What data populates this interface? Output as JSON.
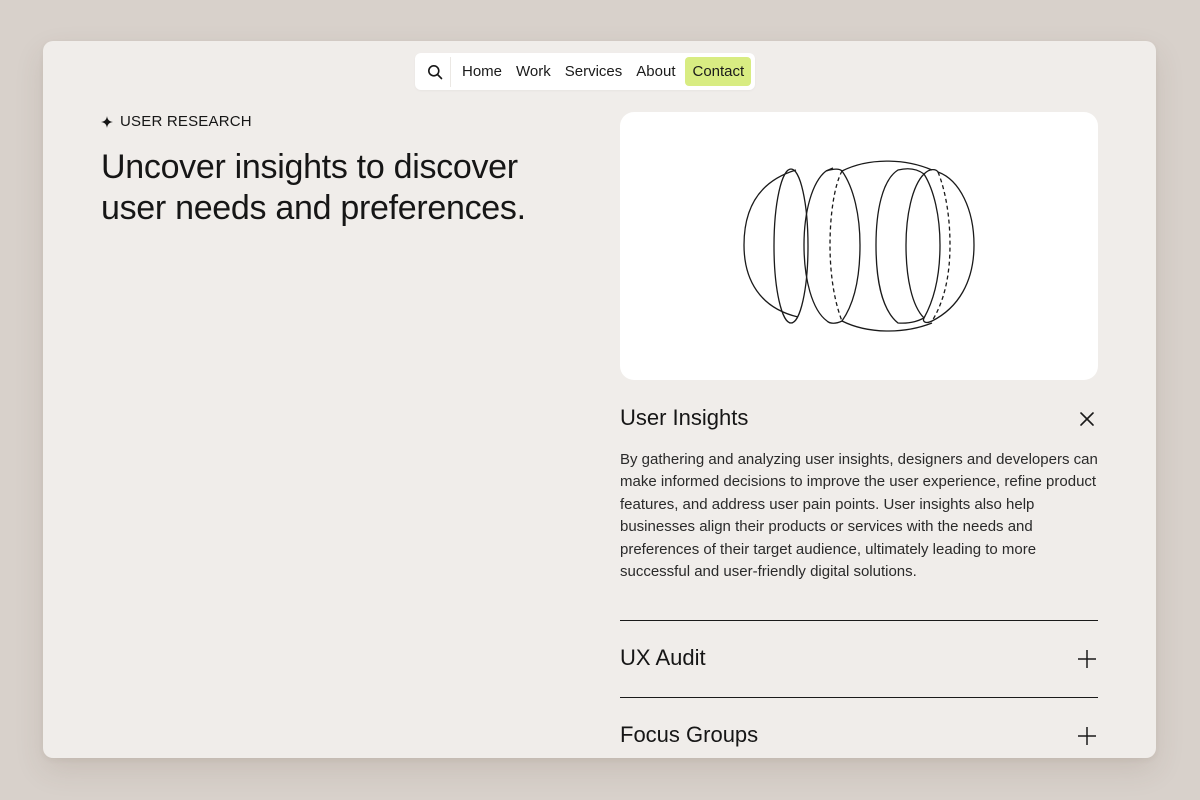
{
  "nav": {
    "search_icon": "search-icon",
    "items": [
      "Home",
      "Work",
      "Services",
      "About",
      "Contact"
    ],
    "accent_color": "#d8ec82"
  },
  "hero": {
    "eyebrow": "USER RESEARCH",
    "eyebrow_icon": "sparkle-icon",
    "headline": "Uncover insights to discover user needs and preferences."
  },
  "illustration": {
    "icon": "sliced-sphere-illustration"
  },
  "accordion": {
    "open": {
      "title": "User Insights",
      "icon": "close-icon",
      "body": "By gathering and analyzing user insights, designers and developers can make informed decisions to improve the user experience, refine product features, and address user pain points. User insights also help businesses align their products or services with the needs and preferences of their target audience, ultimately leading to more successful and user-friendly digital solutions."
    },
    "items": [
      {
        "title": "UX Audit",
        "icon": "plus-icon"
      },
      {
        "title": "Focus Groups",
        "icon": "plus-icon"
      }
    ]
  },
  "colors": {
    "page_background": "#d8d1cb",
    "window_background": "#f0edea",
    "card_background": "#ffffff"
  }
}
